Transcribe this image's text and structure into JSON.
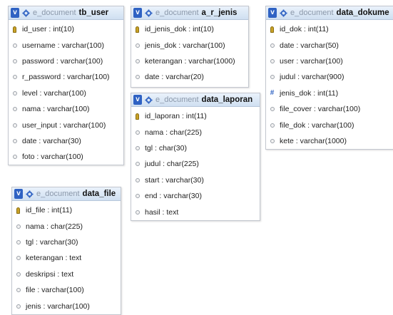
{
  "tables": {
    "tb_user": {
      "db": "e_document",
      "name": "tb_user",
      "fields": [
        {
          "text": "id_user : int(10)",
          "icon": "primary-key-icon"
        },
        {
          "text": "username : varchar(100)",
          "icon": "column-icon"
        },
        {
          "text": "password : varchar(100)",
          "icon": "column-icon"
        },
        {
          "text": "r_password : varchar(100)",
          "icon": "column-icon"
        },
        {
          "text": "level : varchar(100)",
          "icon": "column-icon"
        },
        {
          "text": "nama : varchar(100)",
          "icon": "column-icon"
        },
        {
          "text": "user_input : varchar(100)",
          "icon": "column-icon"
        },
        {
          "text": "date : varchar(30)",
          "icon": "column-icon"
        },
        {
          "text": "foto : varchar(100)",
          "icon": "column-icon"
        }
      ]
    },
    "a_r_jenis": {
      "db": "e_document",
      "name": "a_r_jenis",
      "fields": [
        {
          "text": "id_jenis_dok : int(10)",
          "icon": "primary-key-icon"
        },
        {
          "text": "jenis_dok : varchar(100)",
          "icon": "column-icon"
        },
        {
          "text": "keterangan : varchar(1000)",
          "icon": "column-icon"
        },
        {
          "text": "date : varchar(20)",
          "icon": "column-icon"
        }
      ]
    },
    "data_dokumen": {
      "db": "e_document",
      "name": "data_dokume",
      "fields": [
        {
          "text": "id_dok : int(11)",
          "icon": "primary-key-icon"
        },
        {
          "text": "date : varchar(50)",
          "icon": "column-icon"
        },
        {
          "text": "user : varchar(100)",
          "icon": "column-icon"
        },
        {
          "text": "judul : varchar(900)",
          "icon": "column-icon"
        },
        {
          "text": "jenis_dok : int(11)",
          "icon": "numeric-column-icon"
        },
        {
          "text": "file_cover : varchar(100)",
          "icon": "column-icon"
        },
        {
          "text": "file_dok : varchar(100)",
          "icon": "column-icon"
        },
        {
          "text": "kete : varchar(1000)",
          "icon": "column-icon"
        }
      ]
    },
    "data_laporan": {
      "db": "e_document",
      "name": "data_laporan",
      "fields": [
        {
          "text": "id_laporan : int(11)",
          "icon": "primary-key-icon"
        },
        {
          "text": "nama : char(225)",
          "icon": "column-icon"
        },
        {
          "text": "tgl : char(30)",
          "icon": "column-icon"
        },
        {
          "text": "judul : char(225)",
          "icon": "column-icon"
        },
        {
          "text": "start : varchar(30)",
          "icon": "column-icon"
        },
        {
          "text": "end : varchar(30)",
          "icon": "column-icon"
        },
        {
          "text": "hasil : text",
          "icon": "column-icon"
        }
      ]
    },
    "data_file": {
      "db": "e_document",
      "name": "data_file",
      "fields": [
        {
          "text": "id_file : int(11)",
          "icon": "primary-key-icon"
        },
        {
          "text": "nama : char(225)",
          "icon": "column-icon"
        },
        {
          "text": "tgl : varchar(30)",
          "icon": "column-icon"
        },
        {
          "text": "keterangan : text",
          "icon": "column-icon"
        },
        {
          "text": "deskripsi : text",
          "icon": "column-icon"
        },
        {
          "text": "file : varchar(100)",
          "icon": "column-icon"
        },
        {
          "text": "jenis : varchar(100)",
          "icon": "column-icon"
        }
      ]
    }
  },
  "header_icon_letter": "v"
}
